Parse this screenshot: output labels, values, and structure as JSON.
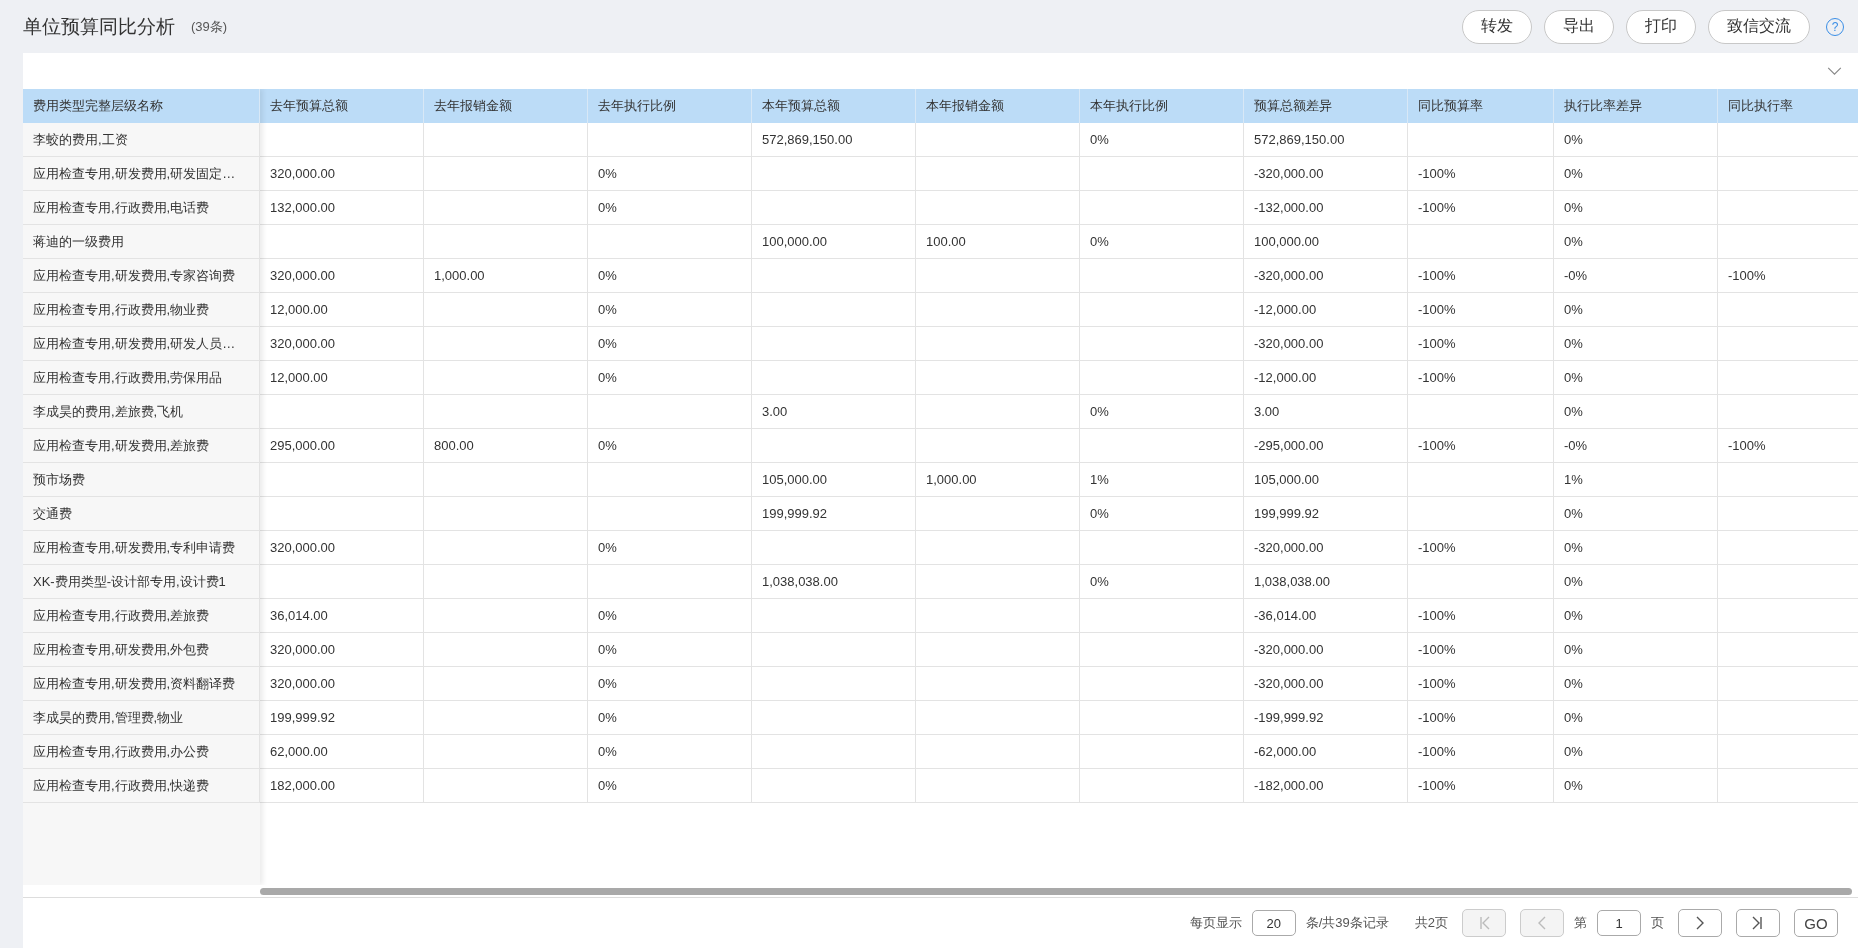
{
  "header": {
    "title": "单位预算同比分析",
    "count": "(39条)",
    "buttons": [
      "转发",
      "导出",
      "打印",
      "致信交流"
    ],
    "help": "?"
  },
  "table": {
    "columns": [
      "费用类型完整层级名称",
      "去年预算总额",
      "去年报销金额",
      "去年执行比例",
      "本年预算总额",
      "本年报销金额",
      "本年执行比例",
      "预算总额差异",
      "同比预算率",
      "执行比率差异",
      "同比执行率"
    ],
    "rows": [
      [
        "李蛟的费用,工资",
        null,
        null,
        null,
        "572,869,150.00",
        null,
        "0%",
        "572,869,150.00",
        null,
        "0%",
        null
      ],
      [
        "应用检查专用,研发费用,研发固定…",
        "320,000.00",
        null,
        "0%",
        null,
        null,
        null,
        "-320,000.00",
        "-100%",
        "0%",
        null
      ],
      [
        "应用检查专用,行政费用,电话费",
        "132,000.00",
        null,
        "0%",
        null,
        null,
        null,
        "-132,000.00",
        "-100%",
        "0%",
        null
      ],
      [
        "蒋迪的一级费用",
        null,
        null,
        null,
        "100,000.00",
        "100.00",
        "0%",
        "100,000.00",
        null,
        "0%",
        null
      ],
      [
        "应用检查专用,研发费用,专家咨询费",
        "320,000.00",
        "1,000.00",
        "0%",
        null,
        null,
        null,
        "-320,000.00",
        "-100%",
        "-0%",
        "-100%"
      ],
      [
        "应用检查专用,行政费用,物业费",
        "12,000.00",
        null,
        "0%",
        null,
        null,
        null,
        "-12,000.00",
        "-100%",
        "0%",
        null
      ],
      [
        "应用检查专用,研发费用,研发人员…",
        "320,000.00",
        null,
        "0%",
        null,
        null,
        null,
        "-320,000.00",
        "-100%",
        "0%",
        null
      ],
      [
        "应用检查专用,行政费用,劳保用品",
        "12,000.00",
        null,
        "0%",
        null,
        null,
        null,
        "-12,000.00",
        "-100%",
        "0%",
        null
      ],
      [
        "李成昊的费用,差旅费,飞机",
        null,
        null,
        null,
        "3.00",
        null,
        "0%",
        "3.00",
        null,
        "0%",
        null
      ],
      [
        "应用检查专用,研发费用,差旅费",
        "295,000.00",
        "800.00",
        "0%",
        null,
        null,
        null,
        "-295,000.00",
        "-100%",
        "-0%",
        "-100%"
      ],
      [
        "预市场费",
        null,
        null,
        null,
        "105,000.00",
        "1,000.00",
        "1%",
        "105,000.00",
        null,
        "1%",
        null
      ],
      [
        "交通费",
        null,
        null,
        null,
        "199,999.92",
        null,
        "0%",
        "199,999.92",
        null,
        "0%",
        null
      ],
      [
        "应用检查专用,研发费用,专利申请费",
        "320,000.00",
        null,
        "0%",
        null,
        null,
        null,
        "-320,000.00",
        "-100%",
        "0%",
        null
      ],
      [
        "XK-费用类型-设计部专用,设计费1",
        null,
        null,
        null,
        "1,038,038.00",
        null,
        "0%",
        "1,038,038.00",
        null,
        "0%",
        null
      ],
      [
        "应用检查专用,行政费用,差旅费",
        "36,014.00",
        null,
        "0%",
        null,
        null,
        null,
        "-36,014.00",
        "-100%",
        "0%",
        null
      ],
      [
        "应用检查专用,研发费用,外包费",
        "320,000.00",
        null,
        "0%",
        null,
        null,
        null,
        "-320,000.00",
        "-100%",
        "0%",
        null
      ],
      [
        "应用检查专用,研发费用,资料翻译费",
        "320,000.00",
        null,
        "0%",
        null,
        null,
        null,
        "-320,000.00",
        "-100%",
        "0%",
        null
      ],
      [
        "李成昊的费用,管理费,物业",
        "199,999.92",
        null,
        "0%",
        null,
        null,
        null,
        "-199,999.92",
        "-100%",
        "0%",
        null
      ],
      [
        "应用检查专用,行政费用,办公费",
        "62,000.00",
        null,
        "0%",
        null,
        null,
        null,
        "-62,000.00",
        "-100%",
        "0%",
        null
      ],
      [
        "应用检查专用,行政费用,快递费",
        "182,000.00",
        null,
        "0%",
        null,
        null,
        null,
        "-182,000.00",
        "-100%",
        "0%",
        null
      ]
    ]
  },
  "pager": {
    "per_page_label": "每页显示",
    "per_page": "20",
    "records": "条/共39条记录",
    "pages": "共2页",
    "nav": [
      {
        "kind": "first",
        "disabled": true
      },
      {
        "kind": "prev",
        "disabled": true
      }
    ],
    "page_prefix": "第",
    "page": "1",
    "page_suffix": "页",
    "nav_after": [
      {
        "kind": "next",
        "disabled": false
      },
      {
        "kind": "last",
        "disabled": false
      }
    ],
    "go": "GO"
  }
}
